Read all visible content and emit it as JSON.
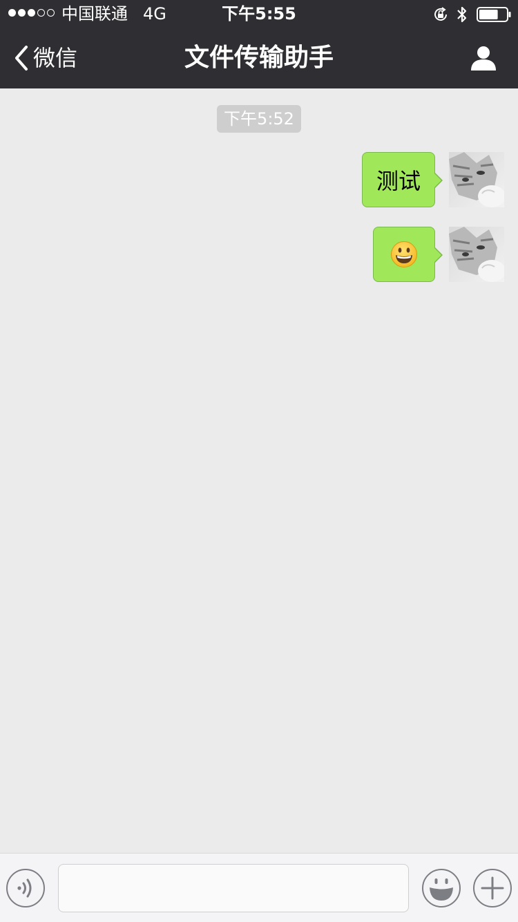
{
  "status_bar": {
    "signal_filled": 3,
    "signal_total": 5,
    "carrier": "中国联通",
    "network": "4G",
    "time": "下午5:55",
    "battery_level": 0.7
  },
  "nav": {
    "back_label": "微信",
    "title": "文件传输助手",
    "back_icon": "chevron-left-icon",
    "profile_icon": "person-icon"
  },
  "chat": {
    "timestamp": "下午5:52",
    "messages": [
      {
        "type": "text",
        "text": "测试",
        "sender": "me"
      },
      {
        "type": "emoji",
        "emoji": "grinning-face",
        "sender": "me"
      }
    ]
  },
  "input_bar": {
    "voice_icon": "voice-icon",
    "input_value": "",
    "emoji_icon": "smiley-icon",
    "plus_icon": "plus-icon"
  },
  "colors": {
    "nav_background": "#2f2f33",
    "chat_background": "#ebebeb",
    "bubble_green": "#a0e75a",
    "timestamp_background": "#cecece"
  }
}
